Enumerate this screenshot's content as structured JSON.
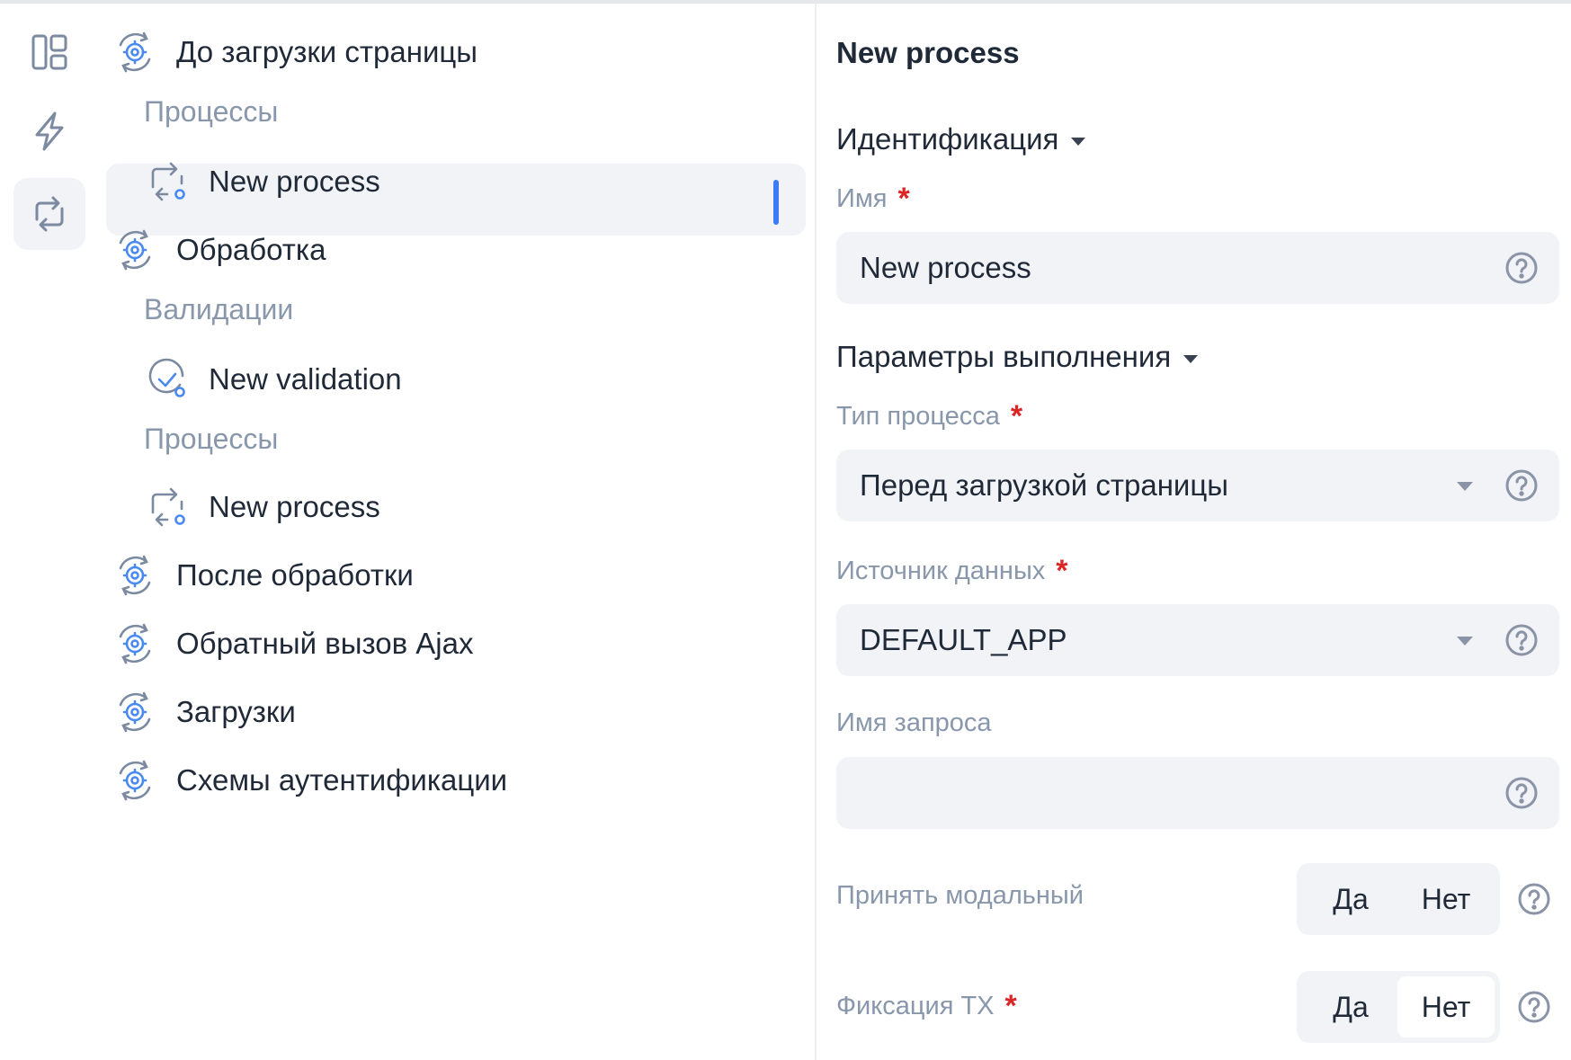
{
  "rail": {
    "items": [
      {
        "icon": "layout-icon",
        "active": false
      },
      {
        "icon": "lightning-icon",
        "active": false
      },
      {
        "icon": "process-cycle-icon",
        "active": true
      }
    ]
  },
  "tree": {
    "items": [
      {
        "label": "До загрузки страницы",
        "type": "point",
        "icon": "gear-cycle-icon"
      },
      {
        "label": "Процессы",
        "type": "group"
      },
      {
        "label": "New process",
        "type": "process",
        "icon": "process-cycle-icon",
        "selected": true
      },
      {
        "label": "Обработка",
        "type": "point",
        "icon": "gear-cycle-icon"
      },
      {
        "label": "Валидации",
        "type": "group"
      },
      {
        "label": "New validation",
        "type": "validation",
        "icon": "check-circle-icon"
      },
      {
        "label": "Процессы",
        "type": "group"
      },
      {
        "label": "New process",
        "type": "process",
        "icon": "process-cycle-icon"
      },
      {
        "label": "После обработки",
        "type": "point",
        "icon": "gear-cycle-icon"
      },
      {
        "label": "Обратный вызов Ajax",
        "type": "point",
        "icon": "gear-cycle-icon"
      },
      {
        "label": "Загрузки",
        "type": "point",
        "icon": "gear-cycle-icon"
      },
      {
        "label": "Схемы аутентификации",
        "type": "point",
        "icon": "gear-cycle-icon"
      }
    ]
  },
  "panel": {
    "title": "New process",
    "section_identification": "Идентификация",
    "name_label": "Имя",
    "name_value": "New process",
    "section_execution": "Параметры выполнения",
    "process_type_label": "Тип процесса",
    "process_type_value": "Перед загрузкой страницы",
    "datasource_label": "Источник данных",
    "datasource_value": "DEFAULT_APP",
    "query_name_label": "Имя запроса",
    "query_name_value": "",
    "accept_modal_label": "Принять модальный",
    "accept_modal_yes": "Да",
    "accept_modal_no": "Нет",
    "accept_modal_selected": "none",
    "commit_tx_label": "Фиксация TX",
    "commit_tx_yes": "Да",
    "commit_tx_no": "Нет",
    "commit_tx_selected": "no",
    "required_mark": "*"
  },
  "colors": {
    "accent": "#3b7bf5",
    "required": "#dc2626",
    "muted_label": "#8897ab",
    "field_bg": "#f1f3f6"
  }
}
